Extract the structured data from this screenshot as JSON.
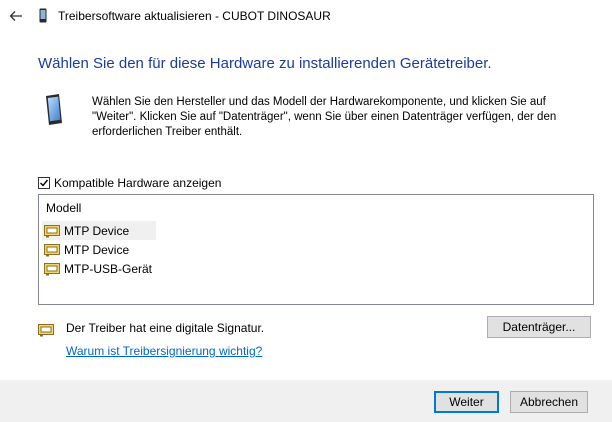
{
  "window": {
    "title": "Treibersoftware aktualisieren - CUBOT DINOSAUR"
  },
  "heading": "Wählen Sie den für diese Hardware zu installierenden Gerätetreiber.",
  "instructions": "Wählen Sie den Hersteller und das Modell der Hardwarekomponente, und klicken Sie auf \"Weiter\". Klicken Sie auf \"Datenträger\", wenn Sie über einen Datenträger verfügen, der den erforderlichen Treiber enthält.",
  "compatible_checkbox": {
    "label": "Kompatible Hardware anzeigen",
    "checked": true
  },
  "model_list": {
    "header": "Modell",
    "items": [
      {
        "label": "MTP Device",
        "selected": true
      },
      {
        "label": "MTP Device",
        "selected": false
      },
      {
        "label": "MTP-USB-Gerät",
        "selected": false
      }
    ]
  },
  "signature": {
    "text": "Der Treiber hat eine digitale Signatur.",
    "link": "Warum ist Treibersignierung wichtig?"
  },
  "buttons": {
    "disk": "Datenträger...",
    "next": "Weiter",
    "cancel": "Abbrechen"
  },
  "icons": {
    "back": "back-arrow-icon",
    "device": "phone-device-icon",
    "driver": "driver-package-icon",
    "signature": "signed-driver-icon"
  },
  "colors": {
    "heading": "#1a3c9c",
    "link": "#0066cc",
    "footer": "#f0f0f0",
    "default_button_border": "#0078d7"
  }
}
